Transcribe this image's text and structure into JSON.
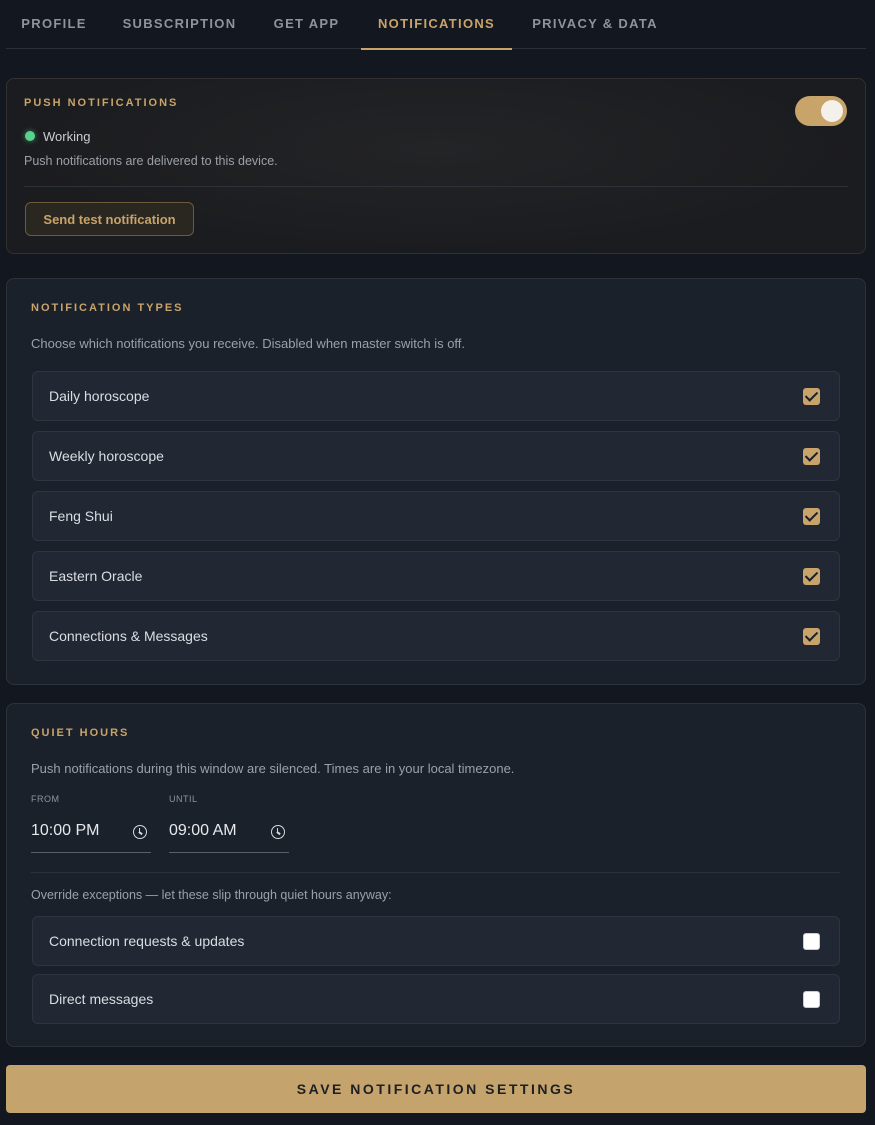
{
  "tabs": [
    {
      "label": "PROFILE",
      "active": false
    },
    {
      "label": "SUBSCRIPTION",
      "active": false
    },
    {
      "label": "GET APP",
      "active": false
    },
    {
      "label": "NOTIFICATIONS",
      "active": true
    },
    {
      "label": "PRIVACY & DATA",
      "active": false
    }
  ],
  "push": {
    "title": "PUSH NOTIFICATIONS",
    "status": "Working",
    "status_color": "#57d38b",
    "description": "Push notifications are delivered to this device.",
    "toggle_on": true,
    "test_button": "Send test notification"
  },
  "types": {
    "title": "NOTIFICATION TYPES",
    "description": "Choose which notifications you receive. Disabled when master switch is off.",
    "items": [
      {
        "label": "Daily horoscope",
        "checked": true
      },
      {
        "label": "Weekly horoscope",
        "checked": true
      },
      {
        "label": "Feng Shui",
        "checked": true
      },
      {
        "label": "Eastern Oracle",
        "checked": true
      },
      {
        "label": "Connections & Messages",
        "checked": true
      }
    ]
  },
  "quiet": {
    "title": "QUIET HOURS",
    "description": "Push notifications during this window are silenced. Times are in your local timezone.",
    "from_label": "FROM",
    "from_value": "10:00 PM",
    "until_label": "UNTIL",
    "until_value": "09:00 AM",
    "override_text": "Override exceptions — let these slip through quiet hours anyway:",
    "exceptions": [
      {
        "label": "Connection requests & updates",
        "checked": false
      },
      {
        "label": "Direct messages",
        "checked": false
      }
    ]
  },
  "save_button": "SAVE NOTIFICATION SETTINGS",
  "colors": {
    "accent": "#c8a36a",
    "background": "#121720",
    "card": "#1b212b",
    "status_ok": "#57d38b"
  }
}
